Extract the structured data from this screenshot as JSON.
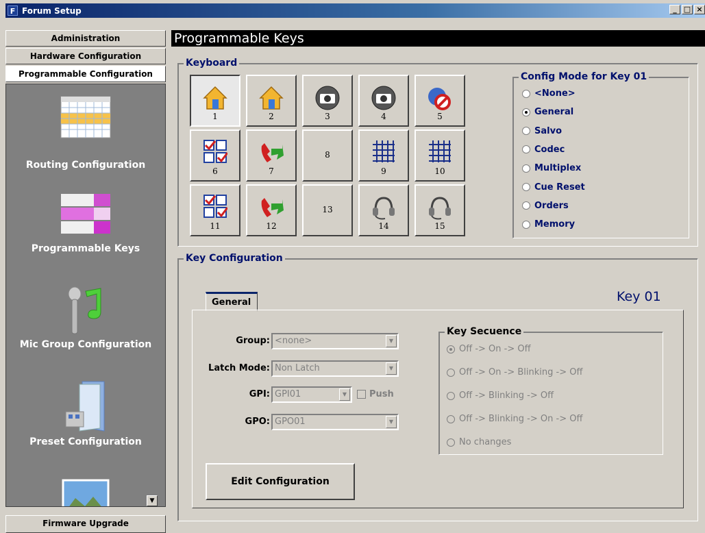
{
  "window": {
    "icon_letter": "F",
    "title": "Forum Setup",
    "minimize": "_",
    "maximize": "□",
    "close": "×"
  },
  "nav": {
    "tabs": [
      "Administration",
      "Hardware Configuration",
      "Programmable Configuration"
    ],
    "active_tab": "Programmable Configuration",
    "items": [
      {
        "label": "Routing Configuration",
        "icon": "calendar-grid-icon"
      },
      {
        "label": "Programmable Keys",
        "icon": "key-grid-icon"
      },
      {
        "label": "Mic Group Configuration",
        "icon": "microphone-note-icon"
      },
      {
        "label": "Preset Configuration",
        "icon": "folder-preset-icon"
      },
      {
        "label": "",
        "icon": "landscape-photo-icon"
      }
    ],
    "bottom_tab": "Firmware Upgrade"
  },
  "main": {
    "header": "Programmable Keys",
    "keyboard": {
      "legend": "Keyboard",
      "keys": [
        {
          "num": "1",
          "icon": "house-icon"
        },
        {
          "num": "2",
          "icon": "house-icon"
        },
        {
          "num": "3",
          "icon": "camera-icon"
        },
        {
          "num": "4",
          "icon": "camera-icon"
        },
        {
          "num": "5",
          "icon": "blocked-globe-icon"
        },
        {
          "num": "6",
          "icon": "checklist-icon"
        },
        {
          "num": "7",
          "icon": "phone-arrow-icon"
        },
        {
          "num": "8",
          "icon": ""
        },
        {
          "num": "9",
          "icon": "grid-matrix-icon"
        },
        {
          "num": "10",
          "icon": "grid-matrix-icon"
        },
        {
          "num": "11",
          "icon": "checklist-icon"
        },
        {
          "num": "12",
          "icon": "phone-arrow-icon"
        },
        {
          "num": "13",
          "icon": ""
        },
        {
          "num": "14",
          "icon": "headset-icon"
        },
        {
          "num": "15",
          "icon": "headset-icon"
        }
      ],
      "selected_key": "1"
    },
    "config_mode": {
      "legend": "Config Mode for Key 01",
      "options": [
        "<None>",
        "General",
        "Salvo",
        "Codec",
        "Multiplex",
        "Cue Reset",
        "Orders",
        "Memory"
      ],
      "selected": "General"
    },
    "key_config": {
      "legend": "Key Configuration",
      "key_label": "Key 01",
      "tab": "General",
      "group_label": "Group:",
      "group_value": "<none>",
      "latch_label": "Latch Mode:",
      "latch_value": "Non Latch",
      "gpi_label": "GPI:",
      "gpi_value": "GPI01",
      "push_label": "Push",
      "gpo_label": "GPO:",
      "gpo_value": "GPO01",
      "edit_button": "Edit Configuration",
      "sequence": {
        "legend": "Key Secuence",
        "options": [
          "Off -> On -> Off",
          "Off -> On -> Blinking -> Off",
          "Off -> Blinking -> Off",
          "Off -> Blinking -> On -> Off",
          "No changes"
        ],
        "selected": "Off -> On -> Off"
      }
    }
  },
  "colors": {
    "title_bar_start": "#0a246a",
    "title_bar_end": "#a6caf0",
    "legend_text": "#00106c",
    "panel_bg": "#d4d0c8",
    "nav_panel_bg": "#808080"
  }
}
